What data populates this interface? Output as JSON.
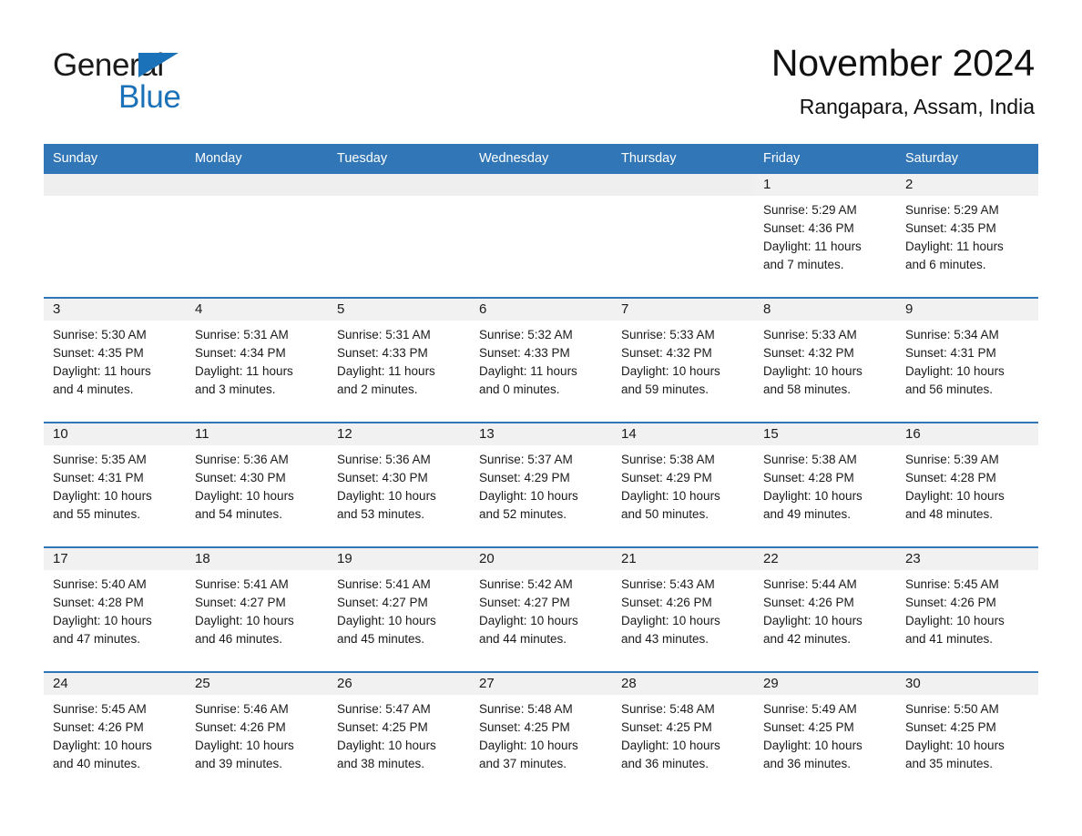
{
  "brand": {
    "name_part1": "General",
    "name_part2": "Blue",
    "triangle_icon": "triangle-icon",
    "accent_color": "#1c72b8"
  },
  "header": {
    "month_title": "November 2024",
    "location": "Rangapara, Assam, India"
  },
  "theme": {
    "header_bg": "#3176b6",
    "daynum_bg": "#f1f1f1",
    "cell_bg": "#ffffff",
    "text": "#1a1a1a"
  },
  "weekday_headers": [
    "Sunday",
    "Monday",
    "Tuesday",
    "Wednesday",
    "Thursday",
    "Friday",
    "Saturday"
  ],
  "weeks": [
    [
      {
        "day": "",
        "lines": []
      },
      {
        "day": "",
        "lines": []
      },
      {
        "day": "",
        "lines": []
      },
      {
        "day": "",
        "lines": []
      },
      {
        "day": "",
        "lines": []
      },
      {
        "day": "1",
        "lines": [
          "Sunrise: 5:29 AM",
          "Sunset: 4:36 PM",
          "Daylight: 11 hours",
          "and 7 minutes."
        ]
      },
      {
        "day": "2",
        "lines": [
          "Sunrise: 5:29 AM",
          "Sunset: 4:35 PM",
          "Daylight: 11 hours",
          "and 6 minutes."
        ]
      }
    ],
    [
      {
        "day": "3",
        "lines": [
          "Sunrise: 5:30 AM",
          "Sunset: 4:35 PM",
          "Daylight: 11 hours",
          "and 4 minutes."
        ]
      },
      {
        "day": "4",
        "lines": [
          "Sunrise: 5:31 AM",
          "Sunset: 4:34 PM",
          "Daylight: 11 hours",
          "and 3 minutes."
        ]
      },
      {
        "day": "5",
        "lines": [
          "Sunrise: 5:31 AM",
          "Sunset: 4:33 PM",
          "Daylight: 11 hours",
          "and 2 minutes."
        ]
      },
      {
        "day": "6",
        "lines": [
          "Sunrise: 5:32 AM",
          "Sunset: 4:33 PM",
          "Daylight: 11 hours",
          "and 0 minutes."
        ]
      },
      {
        "day": "7",
        "lines": [
          "Sunrise: 5:33 AM",
          "Sunset: 4:32 PM",
          "Daylight: 10 hours",
          "and 59 minutes."
        ]
      },
      {
        "day": "8",
        "lines": [
          "Sunrise: 5:33 AM",
          "Sunset: 4:32 PM",
          "Daylight: 10 hours",
          "and 58 minutes."
        ]
      },
      {
        "day": "9",
        "lines": [
          "Sunrise: 5:34 AM",
          "Sunset: 4:31 PM",
          "Daylight: 10 hours",
          "and 56 minutes."
        ]
      }
    ],
    [
      {
        "day": "10",
        "lines": [
          "Sunrise: 5:35 AM",
          "Sunset: 4:31 PM",
          "Daylight: 10 hours",
          "and 55 minutes."
        ]
      },
      {
        "day": "11",
        "lines": [
          "Sunrise: 5:36 AM",
          "Sunset: 4:30 PM",
          "Daylight: 10 hours",
          "and 54 minutes."
        ]
      },
      {
        "day": "12",
        "lines": [
          "Sunrise: 5:36 AM",
          "Sunset: 4:30 PM",
          "Daylight: 10 hours",
          "and 53 minutes."
        ]
      },
      {
        "day": "13",
        "lines": [
          "Sunrise: 5:37 AM",
          "Sunset: 4:29 PM",
          "Daylight: 10 hours",
          "and 52 minutes."
        ]
      },
      {
        "day": "14",
        "lines": [
          "Sunrise: 5:38 AM",
          "Sunset: 4:29 PM",
          "Daylight: 10 hours",
          "and 50 minutes."
        ]
      },
      {
        "day": "15",
        "lines": [
          "Sunrise: 5:38 AM",
          "Sunset: 4:28 PM",
          "Daylight: 10 hours",
          "and 49 minutes."
        ]
      },
      {
        "day": "16",
        "lines": [
          "Sunrise: 5:39 AM",
          "Sunset: 4:28 PM",
          "Daylight: 10 hours",
          "and 48 minutes."
        ]
      }
    ],
    [
      {
        "day": "17",
        "lines": [
          "Sunrise: 5:40 AM",
          "Sunset: 4:28 PM",
          "Daylight: 10 hours",
          "and 47 minutes."
        ]
      },
      {
        "day": "18",
        "lines": [
          "Sunrise: 5:41 AM",
          "Sunset: 4:27 PM",
          "Daylight: 10 hours",
          "and 46 minutes."
        ]
      },
      {
        "day": "19",
        "lines": [
          "Sunrise: 5:41 AM",
          "Sunset: 4:27 PM",
          "Daylight: 10 hours",
          "and 45 minutes."
        ]
      },
      {
        "day": "20",
        "lines": [
          "Sunrise: 5:42 AM",
          "Sunset: 4:27 PM",
          "Daylight: 10 hours",
          "and 44 minutes."
        ]
      },
      {
        "day": "21",
        "lines": [
          "Sunrise: 5:43 AM",
          "Sunset: 4:26 PM",
          "Daylight: 10 hours",
          "and 43 minutes."
        ]
      },
      {
        "day": "22",
        "lines": [
          "Sunrise: 5:44 AM",
          "Sunset: 4:26 PM",
          "Daylight: 10 hours",
          "and 42 minutes."
        ]
      },
      {
        "day": "23",
        "lines": [
          "Sunrise: 5:45 AM",
          "Sunset: 4:26 PM",
          "Daylight: 10 hours",
          "and 41 minutes."
        ]
      }
    ],
    [
      {
        "day": "24",
        "lines": [
          "Sunrise: 5:45 AM",
          "Sunset: 4:26 PM",
          "Daylight: 10 hours",
          "and 40 minutes."
        ]
      },
      {
        "day": "25",
        "lines": [
          "Sunrise: 5:46 AM",
          "Sunset: 4:26 PM",
          "Daylight: 10 hours",
          "and 39 minutes."
        ]
      },
      {
        "day": "26",
        "lines": [
          "Sunrise: 5:47 AM",
          "Sunset: 4:25 PM",
          "Daylight: 10 hours",
          "and 38 minutes."
        ]
      },
      {
        "day": "27",
        "lines": [
          "Sunrise: 5:48 AM",
          "Sunset: 4:25 PM",
          "Daylight: 10 hours",
          "and 37 minutes."
        ]
      },
      {
        "day": "28",
        "lines": [
          "Sunrise: 5:48 AM",
          "Sunset: 4:25 PM",
          "Daylight: 10 hours",
          "and 36 minutes."
        ]
      },
      {
        "day": "29",
        "lines": [
          "Sunrise: 5:49 AM",
          "Sunset: 4:25 PM",
          "Daylight: 10 hours",
          "and 36 minutes."
        ]
      },
      {
        "day": "30",
        "lines": [
          "Sunrise: 5:50 AM",
          "Sunset: 4:25 PM",
          "Daylight: 10 hours",
          "and 35 minutes."
        ]
      }
    ]
  ]
}
